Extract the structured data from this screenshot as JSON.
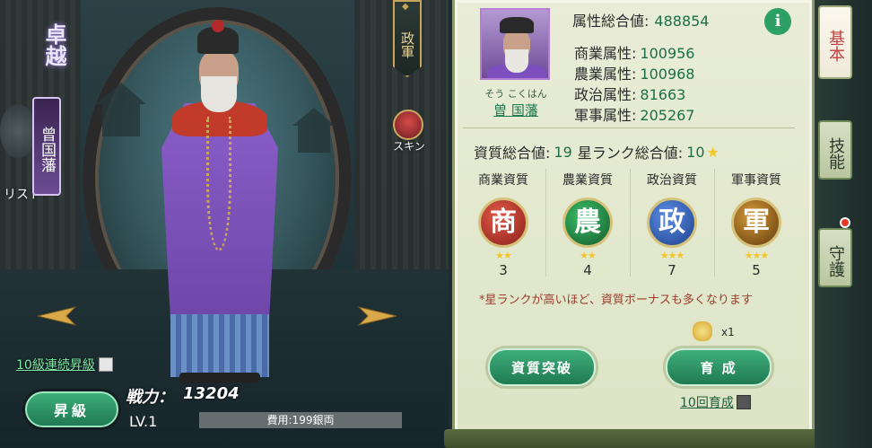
{
  "hero": {
    "title_mark": "卓越",
    "name_vertical": "曾国藩",
    "list_label": "リスト",
    "gov_tag": "政軍",
    "skin_label": "スキン"
  },
  "bottom_left": {
    "bulk_level_label": "10級連続昇級",
    "levelup_label": "昇級",
    "power_label": "戦力：",
    "power_value": "13204",
    "level_label": "LV.1",
    "cost_label": "費用:199銀両"
  },
  "profile": {
    "name_reading": "そう こくはん",
    "name": "曽 国藩",
    "total_attr_label": "属性総合値:",
    "total_attr_value": "488854",
    "stats": [
      {
        "label": "商業属性:",
        "value": "100956"
      },
      {
        "label": "農業属性:",
        "value": "100968"
      },
      {
        "label": "政治属性:",
        "value": "81663"
      },
      {
        "label": "軍事属性:",
        "value": "205267"
      }
    ],
    "info_icon": "i"
  },
  "qualities": {
    "total_label": "資質総合値:",
    "total_value": "19",
    "star_rank_label": "星ランク総合値:",
    "star_rank_value": "10",
    "items": [
      {
        "header": "商業資質",
        "glyph": "商",
        "stars": "★★",
        "value": "3",
        "color": "#b8322a"
      },
      {
        "header": "農業資質",
        "glyph": "農",
        "stars": "★★",
        "value": "4",
        "color": "#1f7a3e"
      },
      {
        "header": "政治資質",
        "glyph": "政",
        "stars": "★★★",
        "value": "7",
        "color": "#2d5bb0"
      },
      {
        "header": "軍事資質",
        "glyph": "軍",
        "stars": "★★★",
        "value": "5",
        "color": "#8a5a18"
      }
    ],
    "note": "*星ランクが高いほど、資質ボーナスも多くなります"
  },
  "actions": {
    "item_count": "x1",
    "breakthrough_label": "資質突破",
    "train_label": "育 成",
    "ten_train_label": "10回育成"
  },
  "side_tabs": [
    "基本",
    "技能",
    "守護"
  ]
}
